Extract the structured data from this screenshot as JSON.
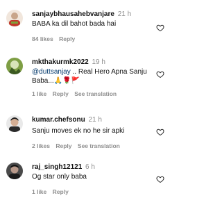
{
  "comments": [
    {
      "username": "sanjaybhausahebvanjare",
      "time": "21 h",
      "text": "BABA ka dil bahot bada hai",
      "likes": "84 likes",
      "reply": "Reply",
      "avatar_colors": [
        "#f2e4d8",
        "#c44",
        "#8a3"
      ]
    },
    {
      "username": "mkthakurmk2022",
      "time": "19 h",
      "mention": "@duttsanjay",
      "text": " .. Real Hero Apna Sanju Baba...🙏🌹🚩",
      "likes": "1 like",
      "reply": "Reply",
      "see_translation": "See translation",
      "avatar_colors": [
        "#6b8f3a",
        "#cfd9b0",
        "#3c5a22"
      ]
    },
    {
      "username": "kumar.chefsonu",
      "time": "21 h",
      "text": "Sanju moves ek no he sir apki",
      "likes": "2 likes",
      "reply": "Reply",
      "see_translation": "See translation",
      "avatar_colors": [
        "#222",
        "#d9b7a0",
        "#555"
      ]
    },
    {
      "username": "raj_singh12121",
      "time": "6 h",
      "text": "Og star only baba",
      "likes": "1 like",
      "reply": "Reply",
      "avatar_colors": [
        "#3a3a3a",
        "#b89a86",
        "#1e1e1e"
      ]
    }
  ]
}
